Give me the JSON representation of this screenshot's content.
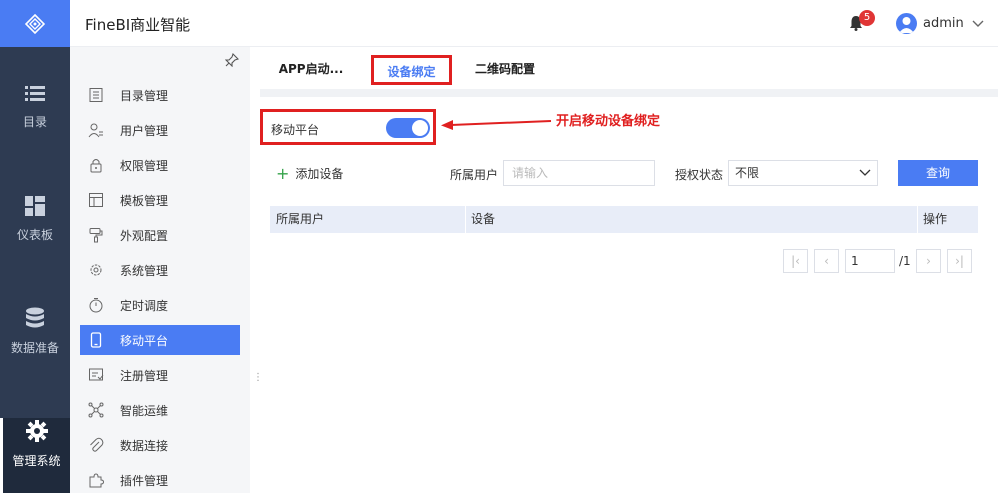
{
  "header": {
    "app_title": "FineBI商业智能",
    "notification_count": "5",
    "user_name": "admin"
  },
  "rail": {
    "items": [
      {
        "label": "目录",
        "icon": "list-icon"
      },
      {
        "label": "仪表板",
        "icon": "dashboard-icon"
      },
      {
        "label": "数据准备",
        "icon": "database-icon"
      },
      {
        "label": "管理系统",
        "icon": "gear-icon",
        "active": true
      }
    ]
  },
  "sidebar": {
    "items": [
      {
        "label": "目录管理",
        "icon": "catalog-icon"
      },
      {
        "label": "用户管理",
        "icon": "user-icon"
      },
      {
        "label": "权限管理",
        "icon": "lock-icon"
      },
      {
        "label": "模板管理",
        "icon": "template-icon"
      },
      {
        "label": "外观配置",
        "icon": "paint-roller-icon"
      },
      {
        "label": "系统管理",
        "icon": "settings-icon"
      },
      {
        "label": "定时调度",
        "icon": "timer-icon"
      },
      {
        "label": "移动平台",
        "icon": "mobile-icon",
        "active": true
      },
      {
        "label": "注册管理",
        "icon": "register-icon"
      },
      {
        "label": "智能运维",
        "icon": "network-icon"
      },
      {
        "label": "数据连接",
        "icon": "paperclip-icon"
      },
      {
        "label": "插件管理",
        "icon": "puzzle-icon"
      }
    ]
  },
  "tabs": [
    {
      "label": "APP启动..."
    },
    {
      "label": "设备绑定",
      "active": true
    },
    {
      "label": "二维码配置"
    }
  ],
  "main": {
    "toggle_label": "移动平台",
    "toggle_on": true,
    "annotation": "开启移动设备绑定",
    "add_device": "添加设备",
    "filter_user_label": "所属用户",
    "filter_user_placeholder": "请输入",
    "filter_status_label": "授权状态",
    "filter_status_value": "不限",
    "query_button": "查询",
    "table_headers": [
      "所属用户",
      "设备",
      "操作"
    ],
    "pager": {
      "current_page": "1",
      "total_text": "/1"
    }
  },
  "colors": {
    "accent": "#4a7cf3",
    "rail_bg": "#2e3b52",
    "annotation_red": "#e02020"
  }
}
